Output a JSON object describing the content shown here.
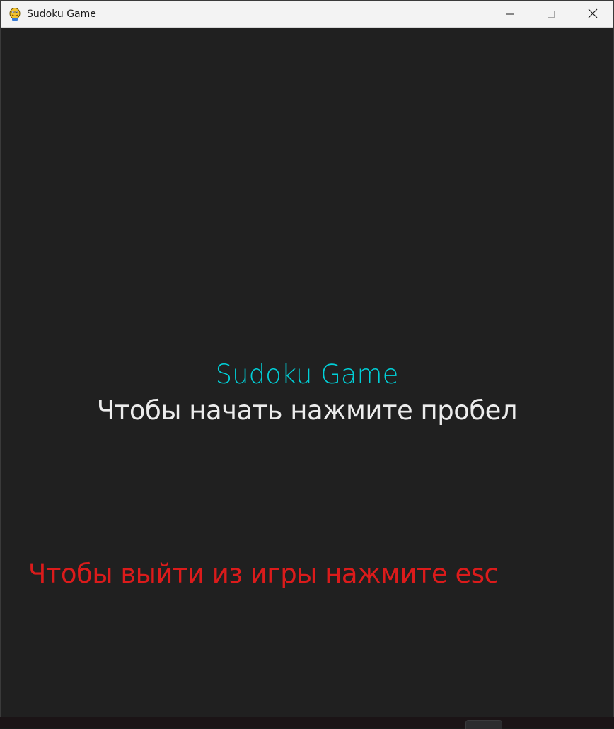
{
  "window": {
    "title": "Sudoku Game",
    "icon": "python-snake-icon",
    "controls": {
      "minimize": "minimize-icon",
      "maximize": "maximize-icon",
      "close": "close-icon"
    }
  },
  "screen": {
    "game_title": "Sudoku Game",
    "start_hint": "Чтобы начать нажмите пробел",
    "exit_hint": "Чтобы выйти из игры нажмите esc"
  },
  "colors": {
    "background": "#202020",
    "title_accent": "#00d0d8",
    "start_text": "#ececec",
    "exit_text": "#dc1b1b"
  }
}
